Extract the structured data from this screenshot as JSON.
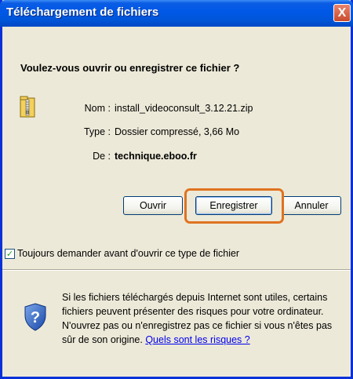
{
  "window": {
    "title": "Téléchargement de fichiers",
    "close_glyph": "X"
  },
  "dialog": {
    "question": "Voulez-vous ouvrir ou enregistrer ce fichier ?",
    "file_icon": "zip-folder-icon",
    "fields": {
      "name_label": "Nom :",
      "name_value": "install_videoconsult_3.12.21.zip",
      "type_label": "Type :",
      "type_value": "Dossier compressé, 3,66 Mo",
      "from_label": "De :",
      "from_value": "technique.eboo.fr"
    }
  },
  "buttons": {
    "open": "Ouvrir",
    "save": "Enregistrer",
    "cancel": "Annuler"
  },
  "checkbox": {
    "checked": true,
    "label": "Toujours demander avant d'ouvrir ce type de fichier"
  },
  "warning": {
    "icon": "shield-question-icon",
    "text": "Si les fichiers téléchargés depuis Internet sont utiles, certains fichiers peuvent présenter des risques pour votre ordinateur. N'ouvrez pas ou n'enregistrez pas ce fichier si vous n'êtes pas sûr de son origine.",
    "link": "Quels sont les risques ?"
  },
  "colors": {
    "title_bar": "#0055d8",
    "dialog_bg": "#ece9d8",
    "highlight": "#e07320",
    "link": "#0000ee"
  }
}
